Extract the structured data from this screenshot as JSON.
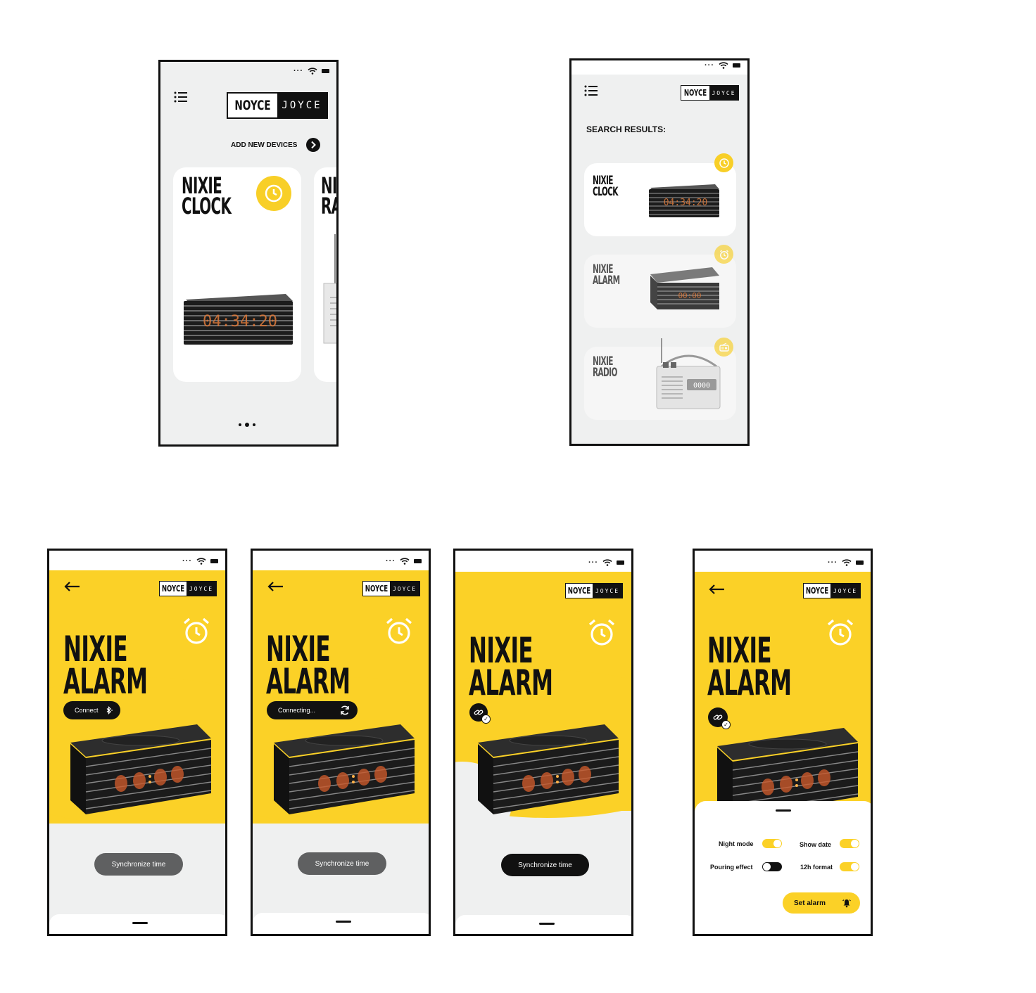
{
  "brand": {
    "name_left": "NOYCE",
    "name_right": "JOYCE"
  },
  "colors": {
    "accent": "#fbd127",
    "dark": "#111111",
    "surface": "#eff0f0",
    "grey_button": "#5f6061"
  },
  "screen_home": {
    "add_devices_label": "ADD NEW DEVICES",
    "card_title_line1": "NIXIE",
    "card_title_line2": "CLOCK",
    "peek_card_line1": "NI",
    "peek_card_line2": "RA",
    "clock_digits": "04:34:20",
    "page_dots": 3,
    "active_dot": 2
  },
  "screen_search": {
    "heading": "SEARCH RESULTS:",
    "results": [
      {
        "line1": "NIXIE",
        "line2": "CLOCK",
        "icon": "clock-icon",
        "digits": "04:34:20"
      },
      {
        "line1": "NIXIE",
        "line2": "ALARM",
        "icon": "alarm-icon",
        "digits": "00:00"
      },
      {
        "line1": "NIXIE",
        "line2": "RADIO",
        "icon": "radio-icon",
        "digits": "0000"
      }
    ]
  },
  "alarm_screens": [
    {
      "title_line1": "NIXIE",
      "title_line2": "ALARM",
      "connect_label": "Connect",
      "sync_label": "Synchronize time"
    },
    {
      "title_line1": "NIXIE",
      "title_line2": "ALARM",
      "connect_label": "Connecting...",
      "sync_label": "Synchronize time"
    },
    {
      "title_line1": "NIXIE",
      "title_line2": "ALARM",
      "sync_label": "Synchronize time"
    },
    {
      "title_line1": "NIXIE",
      "title_line2": "ALARM"
    }
  ],
  "settings_sheet": {
    "night_mode_label": "Night mode",
    "night_mode_on": true,
    "show_date_label": "Show date",
    "show_date_on": true,
    "pouring_effect_label": "Pouring effect",
    "pouring_effect_on": false,
    "format_label": "12h format",
    "format_on": true,
    "set_alarm_label": "Set alarm"
  }
}
